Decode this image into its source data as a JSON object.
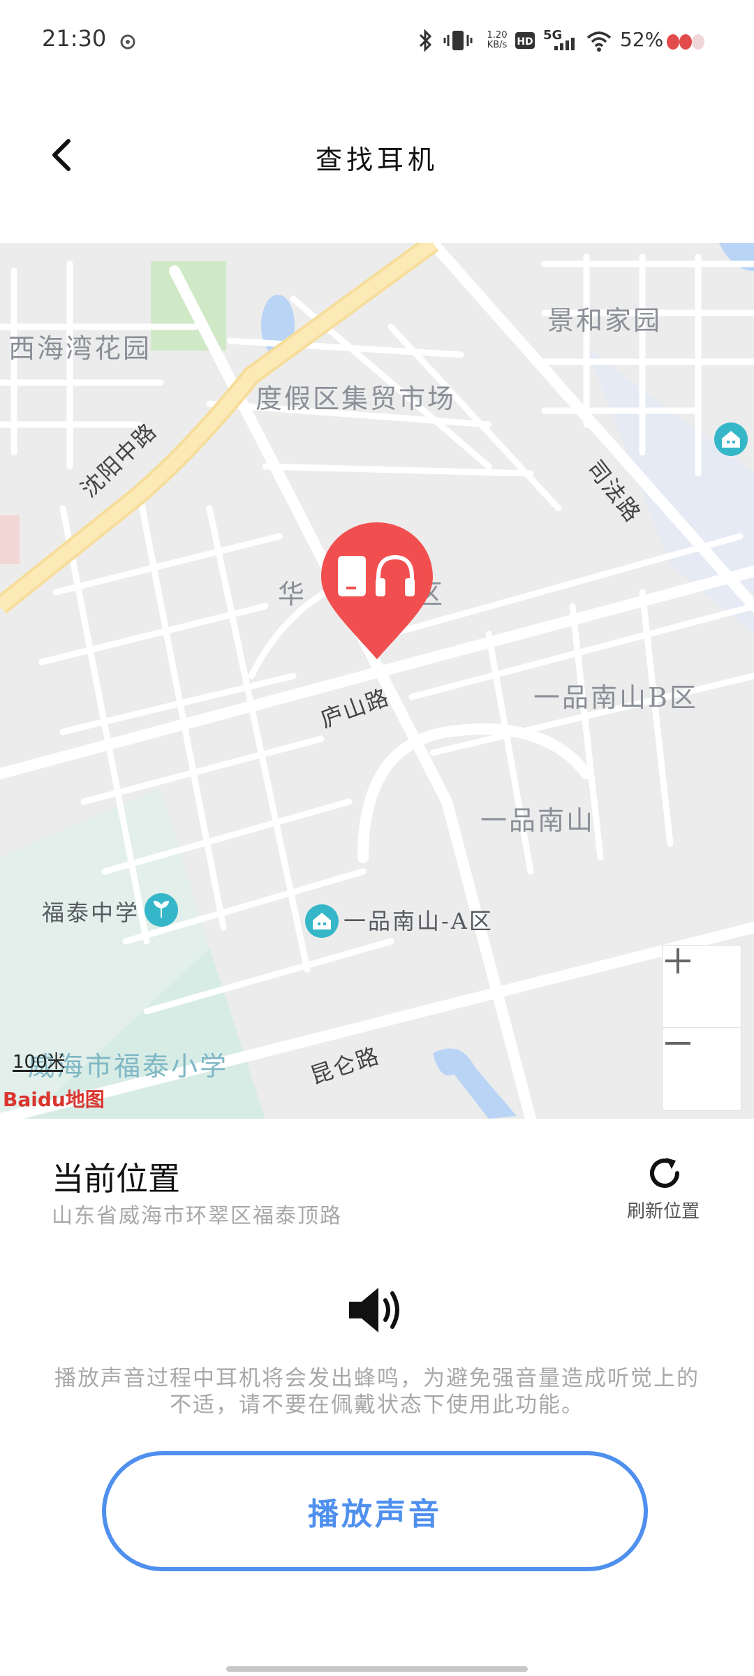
{
  "status_bar": {
    "time": "21:30",
    "net_speed": "1.20 KB/s",
    "network": "5G",
    "battery": "52%"
  },
  "header": {
    "title": "查找耳机",
    "back_icon": "chevron-left-icon"
  },
  "map": {
    "labels": {
      "xihaiwan": "西海湾花园",
      "jingyuan": "景和家园",
      "dujiaqu": "度假区集贸市场",
      "shenyang_road": "沈阳中路",
      "sifa_road": "司法路",
      "huayi": "华",
      "huayi2": "区",
      "lushan_road": "庐山路",
      "yipin_b": "一品南山B区",
      "yipin": "一品南山",
      "futai_school": "福泰中学",
      "yipin_a": "一品南山-A区",
      "weihai_school": "威海市福泰小学",
      "kunlun_road": "昆仑路"
    },
    "scale_text": "100米",
    "logo_text": "Baidu地图",
    "pin_icon": "earphone-location-pin-icon",
    "road_color": "#ffffff",
    "main_road_color": "#fbe5a6",
    "pin_color": "#f14f4f"
  },
  "location": {
    "title": "当前位置",
    "address": "山东省威海市环翠区福泰顶路",
    "refresh_label": "刷新位置"
  },
  "sound": {
    "notice": "播放声音过程中耳机将会发出蜂鸣，为避免强音量造成听觉上的不适，请不要在佩戴状态下使用此功能。",
    "button_label": "播放声音"
  },
  "colors": {
    "accent": "#4f90ef",
    "secondary_text": "#a8a8a8"
  }
}
